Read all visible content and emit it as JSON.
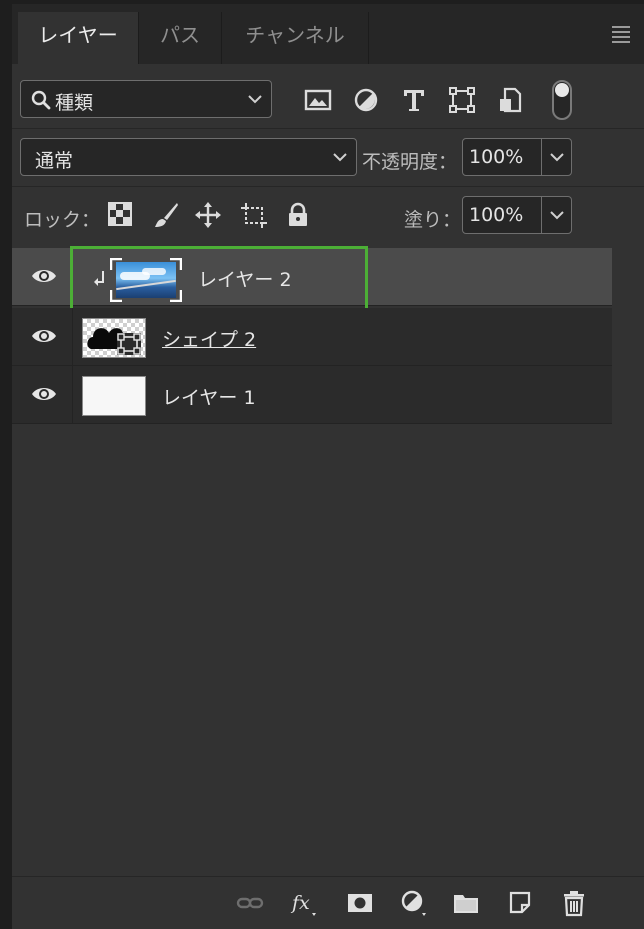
{
  "tabs": [
    {
      "label": "レイヤー",
      "active": true
    },
    {
      "label": "パス",
      "active": false
    },
    {
      "label": "チャンネル",
      "active": false
    }
  ],
  "filter": {
    "kind_label": "種類",
    "filter_icons": [
      "image-filter-icon",
      "adjustment-filter-icon",
      "type-filter-icon",
      "shape-filter-icon",
      "smart-object-filter-icon"
    ]
  },
  "blend": {
    "mode": "通常",
    "opacity_label": "不透明度：",
    "opacity_value": "100%"
  },
  "lock": {
    "label": "ロック：",
    "fill_label": "塗り：",
    "fill_value": "100%"
  },
  "layers": [
    {
      "name": "レイヤー 2",
      "selected": true,
      "clipped": true,
      "thumb": "photo"
    },
    {
      "name": "シェイプ 2",
      "selected": false,
      "clipped": false,
      "thumb": "shape"
    },
    {
      "name": "レイヤー 1",
      "selected": false,
      "clipped": false,
      "thumb": "white"
    }
  ],
  "colors": {
    "panel_bg": "#323232",
    "selection_highlight": "#4caf36",
    "selected_row": "#4b4b4b"
  },
  "footer_icons": [
    "link-layers-icon",
    "fx-icon",
    "add-mask-icon",
    "new-adjustment-icon",
    "new-group-icon",
    "new-layer-icon",
    "delete-layer-icon"
  ]
}
